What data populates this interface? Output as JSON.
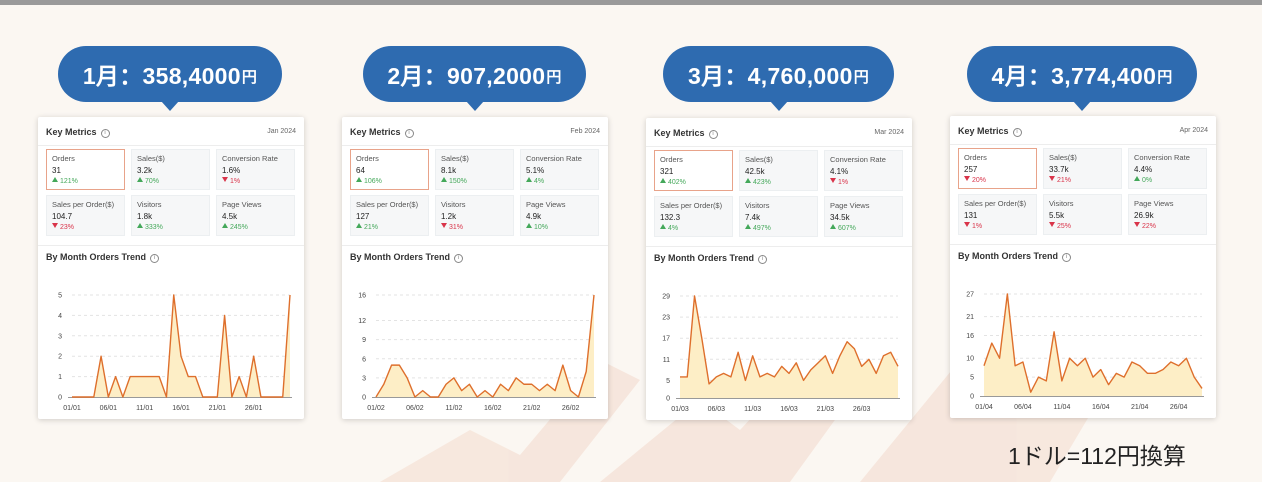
{
  "note": "1ドル=112円換算",
  "months": [
    {
      "bubble_text": "1月：358,4000",
      "yen": "円",
      "card_title": "Key Metrics",
      "date": "Jan 2024",
      "trend_title": "By Month Orders Trend",
      "metrics": [
        {
          "label": "Orders",
          "value": "31",
          "delta": "121%",
          "dir": "up",
          "selected": true
        },
        {
          "label": "Sales($)",
          "value": "3.2k",
          "delta": "70%",
          "dir": "up"
        },
        {
          "label": "Conversion Rate",
          "value": "1.6%",
          "delta": "1%",
          "dir": "down"
        },
        {
          "label": "Sales per Order($)",
          "value": "104.7",
          "delta": "23%",
          "dir": "down"
        },
        {
          "label": "Visitors",
          "value": "1.8k",
          "delta": "333%",
          "dir": "up"
        },
        {
          "label": "Page Views",
          "value": "4.5k",
          "delta": "245%",
          "dir": "up"
        }
      ],
      "chart": {
        "yticks": [
          0,
          1,
          2,
          3,
          4,
          5
        ],
        "ymax": 5,
        "xticks": [
          "01/01",
          "06/01",
          "11/01",
          "16/01",
          "21/01",
          "26/01"
        ],
        "values": [
          0,
          0,
          0,
          0,
          2,
          0,
          1,
          0,
          1,
          1,
          1,
          1,
          1,
          0,
          5,
          2,
          1,
          1,
          0,
          0,
          0,
          4,
          0,
          1,
          0,
          2,
          0,
          0,
          0,
          0,
          5
        ]
      }
    },
    {
      "bubble_text": "2月：907,2000",
      "yen": "円",
      "card_title": "Key Metrics",
      "date": "Feb 2024",
      "trend_title": "By Month Orders Trend",
      "metrics": [
        {
          "label": "Orders",
          "value": "64",
          "delta": "106%",
          "dir": "up",
          "selected": true
        },
        {
          "label": "Sales($)",
          "value": "8.1k",
          "delta": "150%",
          "dir": "up"
        },
        {
          "label": "Conversion Rate",
          "value": "5.1%",
          "delta": "4%",
          "dir": "up"
        },
        {
          "label": "Sales per Order($)",
          "value": "127",
          "delta": "21%",
          "dir": "up"
        },
        {
          "label": "Visitors",
          "value": "1.2k",
          "delta": "31%",
          "dir": "down"
        },
        {
          "label": "Page Views",
          "value": "4.9k",
          "delta": "10%",
          "dir": "up"
        }
      ],
      "chart": {
        "yticks": [
          0,
          3,
          6,
          9,
          12,
          16
        ],
        "ymax": 16,
        "xticks": [
          "01/02",
          "06/02",
          "11/02",
          "16/02",
          "21/02",
          "26/02"
        ],
        "values": [
          0,
          2,
          5,
          5,
          3,
          0,
          1,
          0,
          0,
          2,
          3,
          1,
          2,
          0,
          1,
          0,
          2,
          1,
          3,
          2,
          2,
          1,
          2,
          1,
          5,
          1,
          0,
          4,
          16
        ]
      }
    },
    {
      "bubble_text": "3月：4,760,000",
      "yen": "円",
      "card_title": "Key Metrics",
      "date": "Mar 2024",
      "trend_title": "By Month Orders Trend",
      "metrics": [
        {
          "label": "Orders",
          "value": "321",
          "delta": "402%",
          "dir": "up",
          "selected": true
        },
        {
          "label": "Sales($)",
          "value": "42.5k",
          "delta": "423%",
          "dir": "up"
        },
        {
          "label": "Conversion Rate",
          "value": "4.1%",
          "delta": "1%",
          "dir": "down"
        },
        {
          "label": "Sales per Order($)",
          "value": "132.3",
          "delta": "4%",
          "dir": "up"
        },
        {
          "label": "Visitors",
          "value": "7.4k",
          "delta": "497%",
          "dir": "up"
        },
        {
          "label": "Page Views",
          "value": "34.5k",
          "delta": "607%",
          "dir": "up"
        }
      ],
      "chart": {
        "yticks": [
          0,
          5,
          11,
          17,
          23,
          29
        ],
        "ymax": 29,
        "xticks": [
          "01/03",
          "06/03",
          "11/03",
          "16/03",
          "21/03",
          "26/03"
        ],
        "values": [
          6,
          6,
          29,
          17,
          4,
          6,
          7,
          6,
          13,
          5,
          12,
          6,
          7,
          6,
          9,
          7,
          10,
          5,
          8,
          10,
          12,
          7,
          12,
          16,
          14,
          9,
          11,
          7,
          12,
          13,
          9
        ]
      }
    },
    {
      "bubble_text": "4月：3,774,400",
      "yen": "円",
      "card_title": "Key Metrics",
      "date": "Apr 2024",
      "trend_title": "By Month Orders Trend",
      "metrics": [
        {
          "label": "Orders",
          "value": "257",
          "delta": "20%",
          "dir": "down",
          "selected": true
        },
        {
          "label": "Sales($)",
          "value": "33.7k",
          "delta": "21%",
          "dir": "down"
        },
        {
          "label": "Conversion Rate",
          "value": "4.4%",
          "delta": "0%",
          "dir": "up"
        },
        {
          "label": "Sales per Order($)",
          "value": "131",
          "delta": "1%",
          "dir": "down"
        },
        {
          "label": "Visitors",
          "value": "5.5k",
          "delta": "25%",
          "dir": "down"
        },
        {
          "label": "Page Views",
          "value": "26.9k",
          "delta": "22%",
          "dir": "down"
        }
      ],
      "chart": {
        "yticks": [
          0,
          5,
          10,
          16,
          21,
          27
        ],
        "ymax": 27,
        "xticks": [
          "01/04",
          "06/04",
          "11/04",
          "16/04",
          "21/04",
          "26/04"
        ],
        "values": [
          8,
          14,
          10,
          27,
          8,
          9,
          1,
          5,
          4,
          17,
          4,
          10,
          8,
          10,
          5,
          7,
          3,
          6,
          5,
          9,
          8,
          6,
          6,
          7,
          9,
          8,
          10,
          5,
          2
        ]
      }
    }
  ]
}
